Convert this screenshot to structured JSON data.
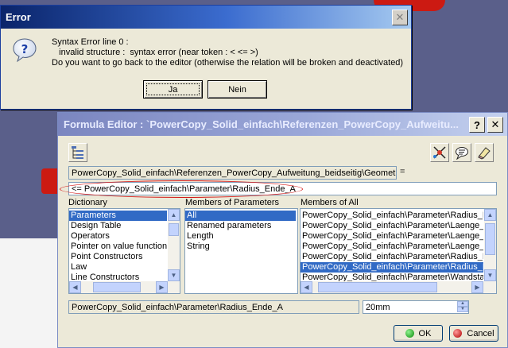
{
  "error_dialog": {
    "title": "Error",
    "close_glyph": "✕",
    "message": "Syntax Error line 0 :\n   invalid structure :  syntax error (near token : < <= >)\nDo you want to go back to the editor (otherwise the relation will be broken and deactivated)",
    "yes_label": "Ja",
    "no_label": "Nein"
  },
  "formula_editor": {
    "title": "Formula Editor : `PowerCopy_Solid_einfach\\Referenzen_PowerCopy_Aufweitu...",
    "help_glyph": "?",
    "close_glyph": "✕",
    "parameter_path": "PowerCopy_Solid_einfach\\Referenzen_PowerCopy_Aufweitung_beidseitig\\Geometrie",
    "equals_sign": "=",
    "formula_text": "<= PowerCopy_Solid_einfach\\Parameter\\Radius_Ende_A",
    "dictionary": {
      "header": "Dictionary",
      "items": [
        "Parameters",
        "Design Table",
        "Operators",
        "Pointer on value function",
        "Point Constructors",
        "Law",
        "Line Constructors"
      ],
      "selected_index": 0
    },
    "members_of_parameters": {
      "header": "Members of Parameters",
      "items": [
        "All",
        "Renamed parameters",
        "Length",
        "String"
      ],
      "selected_index": 0
    },
    "members_of_all": {
      "header": "Members of All",
      "items": [
        "PowerCopy_Solid_einfach\\Parameter\\Radius_R",
        "PowerCopy_Solid_einfach\\Parameter\\Laenge_a",
        "PowerCopy_Solid_einfach\\Parameter\\Laenge_a",
        "PowerCopy_Solid_einfach\\Parameter\\Laenge_a",
        "PowerCopy_Solid_einfach\\Parameter\\Radius_E",
        "PowerCopy_Solid_einfach\\Parameter\\Radius_E",
        "PowerCopy_Solid_einfach\\Parameter\\Wandsta"
      ],
      "selected_index": 5
    },
    "selected_parameter": "PowerCopy_Solid_einfach\\Parameter\\Radius_Ende_A",
    "value": "20mm",
    "ok_label": "OK",
    "cancel_label": "Cancel"
  },
  "colors": {
    "selection": "#316ac5",
    "annotation_oval": "#d41a1a"
  }
}
